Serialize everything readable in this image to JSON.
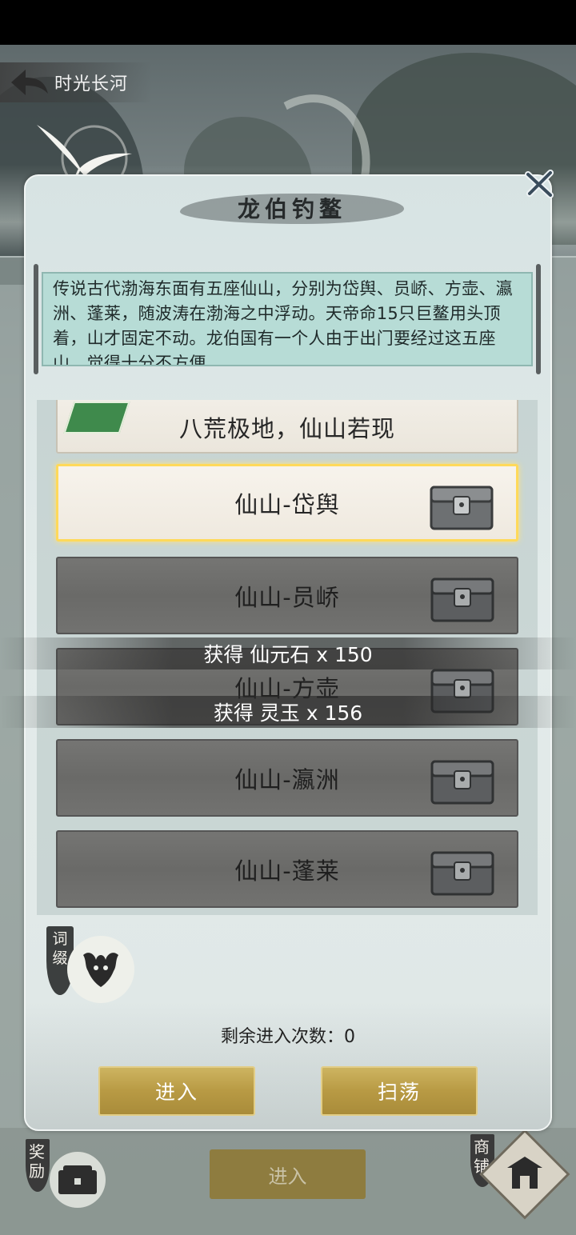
{
  "header": {
    "back_label": "时光长河"
  },
  "dialog": {
    "title": "龙伯钓鳌",
    "description": "传说古代渤海东面有五座仙山，分别为岱舆、员峤、方壶、瀛洲、蓬莱，随波涛在渤海之中浮动。天帝命15只巨鳌用头顶着，山才固定不动。龙伯国有一个人由于出门要经过这五座山，觉得十分不方便……",
    "levels": [
      {
        "name": "八荒极地，仙山若现",
        "state": "header"
      },
      {
        "name": "仙山-岱舆",
        "state": "selected"
      },
      {
        "name": "仙山-员峤",
        "state": "locked"
      },
      {
        "name": "仙山-方壶",
        "state": "locked"
      },
      {
        "name": "仙山-瀛洲",
        "state": "locked"
      },
      {
        "name": "仙山-蓬莱",
        "state": "locked"
      }
    ],
    "affix_label": "词缀",
    "remaining_label": "剩余进入次数：",
    "remaining_count": "0",
    "enter_button": "进入",
    "sweep_button": "扫荡"
  },
  "toasts": [
    "获得 仙元石 x 150",
    "获得 灵玉 x 156"
  ],
  "bottom": {
    "reward_label": "奖励",
    "enter_label": "进入",
    "shop_label": "商铺"
  },
  "colors": {
    "gold": "#b89a44",
    "selected_border": "#ffd95a",
    "scroll_bg": "#b7dcd6"
  }
}
